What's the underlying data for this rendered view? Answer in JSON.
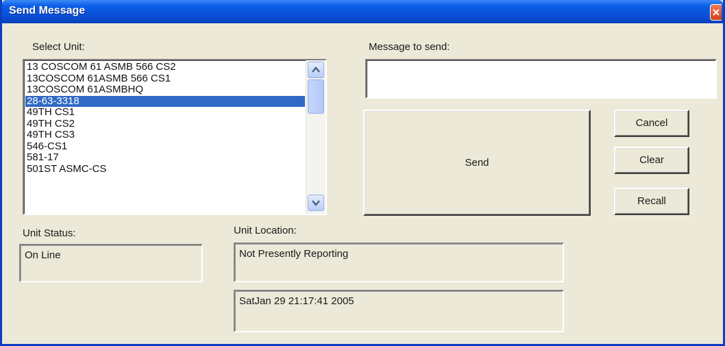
{
  "window": {
    "title": "Send Message",
    "colors": {
      "titlebar": "#0a4fd6",
      "face": "#ece9d8",
      "selection": "#316ac5"
    }
  },
  "select_unit": {
    "label": "Select Unit:",
    "items": [
      "13 COSCOM 61 ASMB 566 CS2",
      "13COSCOM 61ASMB 566 CS1",
      "13COSCOM 61ASMBHQ",
      "28-63-3318",
      "49TH CS1",
      "49TH CS2",
      "49TH CS3",
      "546-CS1",
      "581-17",
      "501ST ASMC-CS"
    ],
    "selected": "28-63-3318"
  },
  "message": {
    "label": "Message to send:",
    "value": ""
  },
  "buttons": {
    "send": "Send",
    "cancel": "Cancel",
    "clear": "Clear",
    "recall": "Recall"
  },
  "unit_status": {
    "label": "Unit Status:",
    "value": "On Line"
  },
  "unit_location": {
    "label": "Unit Location:",
    "value": "Not Presently Reporting",
    "timestamp": "SatJan 29 21:17:41 2005"
  },
  "icons": [
    "close-icon",
    "scroll-up-icon",
    "scroll-down-icon"
  ]
}
